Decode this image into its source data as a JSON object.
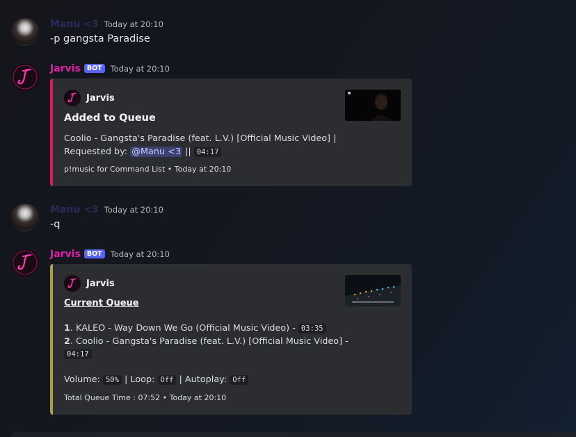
{
  "messages": [
    {
      "author": "Manu <3",
      "timestamp": "Today at 20:10",
      "content": "-p gangsta Paradise"
    },
    {
      "author": "Jarvis",
      "bot_tag": "BOT",
      "timestamp": "Today at 20:10",
      "embed": {
        "author": "Jarvis",
        "title": "Added to Queue",
        "line1": "Coolio - Gangsta's Paradise (feat. L.V.) [Official Music Video] |",
        "requested_by_label": "Requested by:",
        "mention": "@Manu <3",
        "separator": "||",
        "duration": "04:17",
        "footer": "p!music for Command List • Today at 20:10"
      }
    },
    {
      "author": "Manu <3",
      "timestamp": "Today at 20:10",
      "content": "-q"
    },
    {
      "author": "Jarvis",
      "bot_tag": "BOT",
      "timestamp": "Today at 20:10",
      "embed": {
        "author": "Jarvis",
        "title": "Current Queue",
        "queue": [
          {
            "num": "1",
            "title": "KALEO - Way Down We Go (Official Music Video) -",
            "duration": "03:35"
          },
          {
            "num": "2",
            "title": "Coolio - Gangsta's Paradise (feat. L.V.) [Official Music Video] -",
            "duration": "04:17"
          }
        ],
        "volume_label": "Volume:",
        "volume": "50%",
        "loop_label": "| Loop:",
        "loop": "Off",
        "autoplay_label": "| Autoplay:",
        "autoplay": "Off",
        "footer": "Total Queue Time : 07:52 • Today at 20:10"
      }
    }
  ],
  "colors": {
    "bot_name": "#e01ea8",
    "user_name": "#2a2a58",
    "bot_tag": "#5865f2",
    "embed_bg": "#2b2d31",
    "embed_border_1": "#e0195c",
    "embed_border_2": "#a9a04a",
    "mention_bg": "#3c4270"
  }
}
